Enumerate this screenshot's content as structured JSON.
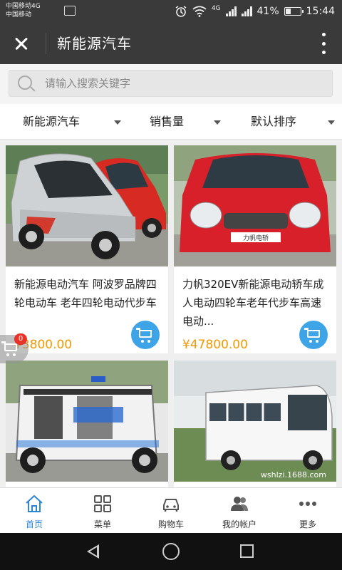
{
  "status_bar": {
    "carrier_1": "中国移动4G",
    "carrier_2": "中国移动",
    "network": "4G",
    "battery_pct": "41%",
    "battery_level": 0.41,
    "time": "15:44"
  },
  "header": {
    "title": "新能源汽车"
  },
  "search": {
    "placeholder": "请输入搜索关键字"
  },
  "filters": [
    {
      "label": "新能源汽车"
    },
    {
      "label": "销售量"
    },
    {
      "label": "默认排序"
    }
  ],
  "products": [
    {
      "name": "新能源电动汽车 阿波罗品牌四轮电动车 老年四轮电动代步车",
      "price": "¥3800.00"
    },
    {
      "name": "力帆320EV新能源电动轿车成人电动四轮车老年代步车高速电动...",
      "price": "¥47800.00"
    },
    {
      "name": "",
      "price": ""
    },
    {
      "name": "",
      "price": ""
    }
  ],
  "floating_cart": {
    "badge_count": "0"
  },
  "watermark": "wshlzi.1688.com",
  "tabbar": [
    {
      "label": "首页",
      "icon": "home-icon"
    },
    {
      "label": "菜单",
      "icon": "menu-grid-icon"
    },
    {
      "label": "购物车",
      "icon": "car-icon"
    },
    {
      "label": "我的帐户",
      "icon": "account-icon"
    },
    {
      "label": "更多",
      "icon": "more-icon"
    }
  ],
  "colors": {
    "accent": "#2b86d6",
    "cart_button": "#3ea4e8",
    "price": "#f39800",
    "header_bg": "#3a3a3a"
  }
}
